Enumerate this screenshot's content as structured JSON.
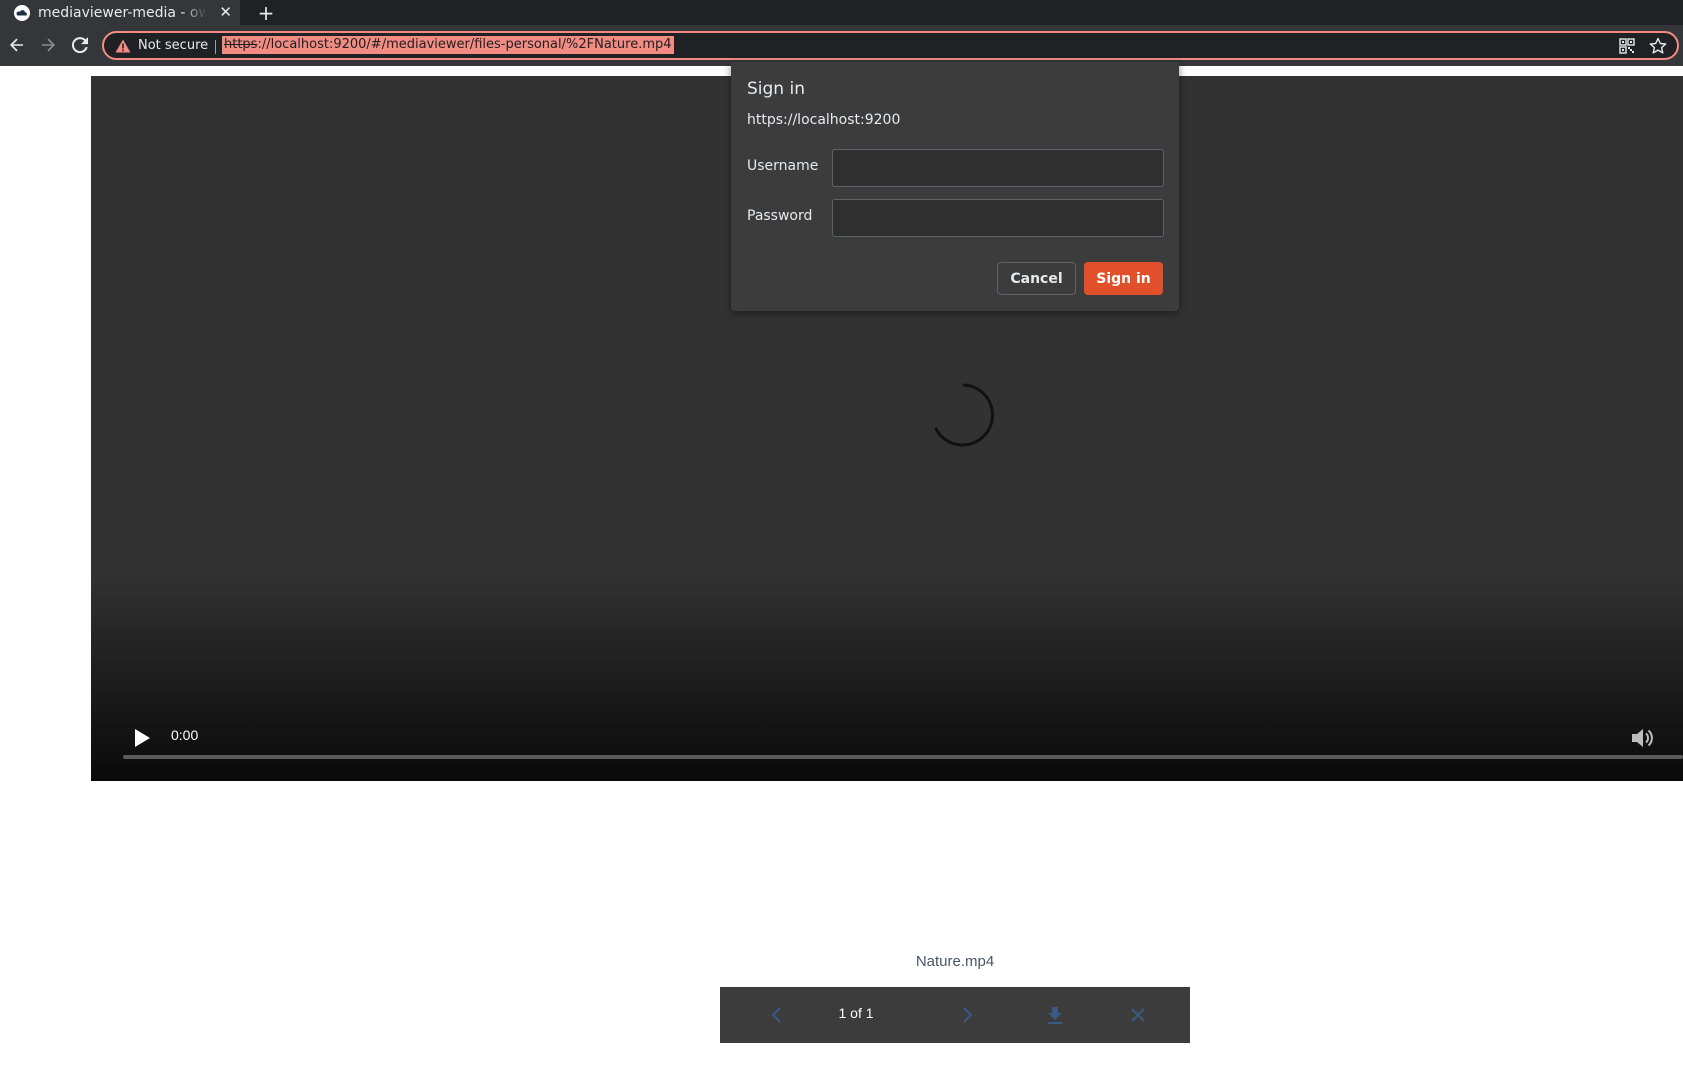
{
  "browser": {
    "tab": {
      "title": "mediaviewer-media - ownCloud",
      "favicon": "owncloud-cloud-icon",
      "close_glyph": "✕"
    },
    "new_tab_glyph": "+",
    "omnibox": {
      "security_text": "Not secure",
      "url_scheme": "https",
      "url_rest": "://localhost:9200/#/mediaviewer/files-personal/%2FNature.mp4"
    },
    "icons": [
      "back-arrow-icon",
      "forward-arrow-icon",
      "reload-icon",
      "warning-icon",
      "qr-code-icon",
      "star-icon"
    ]
  },
  "dialog": {
    "title": "Sign in",
    "origin": "https://localhost:9200",
    "username_label": "Username",
    "username_value": "",
    "password_label": "Password",
    "password_value": "",
    "cancel_label": "Cancel",
    "signin_label": "Sign in"
  },
  "video": {
    "current_time": "0:00",
    "progress": 0,
    "state": "loading"
  },
  "media_viewer": {
    "file_name": "Nature.mp4",
    "page_count": "1 of 1",
    "icons": [
      "chevron-left-icon",
      "chevron-right-icon",
      "download-icon",
      "close-icon"
    ]
  },
  "colors": {
    "accent": "#e2502b",
    "url_highlight": "#f28b82",
    "chrome_bg": "#35363a",
    "dialog_bg": "#3c3c3c",
    "video_bg": "#323232"
  }
}
